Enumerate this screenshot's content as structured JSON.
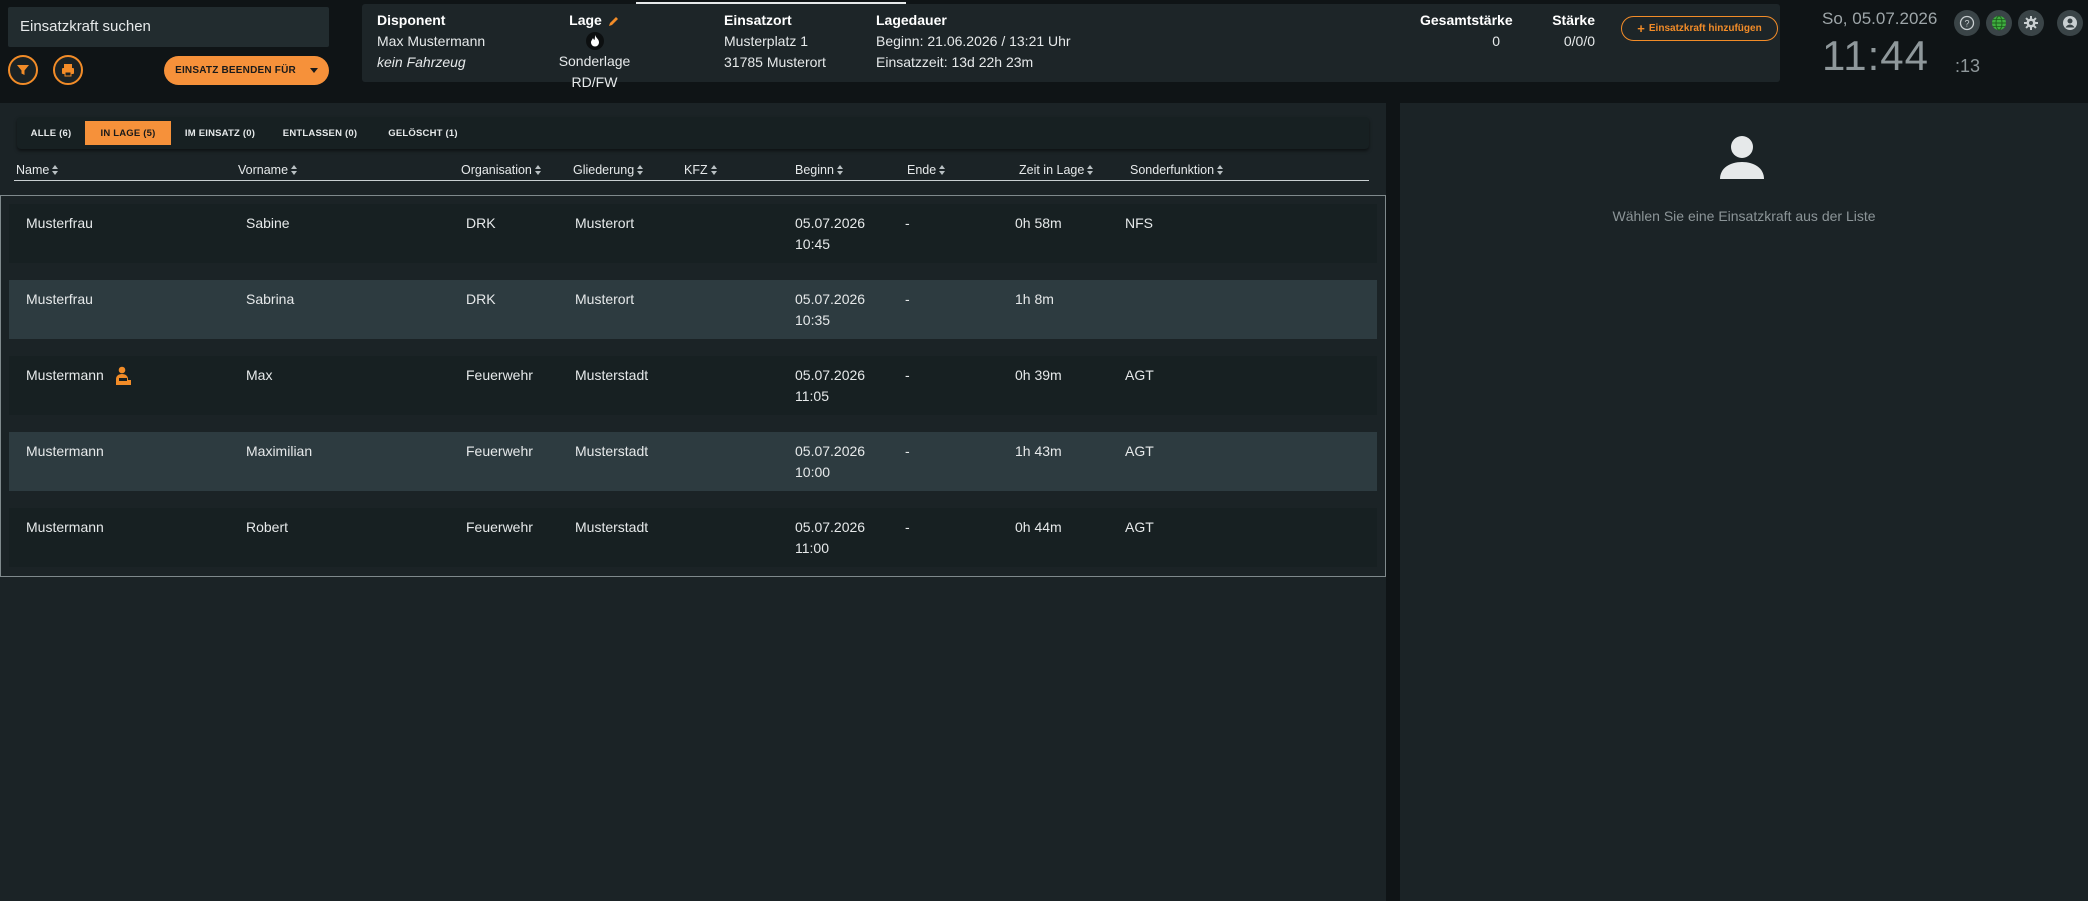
{
  "search": {
    "label": "Einsatzkraft suchen"
  },
  "toolbar": {
    "end_label": "EINSATZ BEENDEN FÜR"
  },
  "info": {
    "disponent_header": "Disponent",
    "disponent_name": "Max Mustermann",
    "disponent_vehicle": "kein Fahrzeug",
    "lage_header": "Lage",
    "lage_value": "Sonderlage RD/FW",
    "einsatzort_header": "Einsatzort",
    "einsatzort_street": "Musterplatz 1",
    "einsatzort_city": "31785 Musterort",
    "lagedauer_header": "Lagedauer",
    "lagedauer_begin": "Beginn: 21.06.2026 / 13:21 Uhr",
    "lagedauer_time": "Einsatzzeit: 13d 22h 23m",
    "gesamt_header": "Gesamtstärke",
    "gesamt_value": "0",
    "staerke_header": "Stärke",
    "staerke_value": "0/0/0",
    "add_label": "Einsatzkraft hinzufügen"
  },
  "clock": {
    "date": "So, 05.07.2026",
    "time": "11:44",
    "seconds": ":13"
  },
  "tabs": [
    {
      "label": "ALLE (6)",
      "active": false
    },
    {
      "label": "IN LAGE (5)",
      "active": true
    },
    {
      "label": "IM EINSATZ (0)",
      "active": false
    },
    {
      "label": "ENTLASSEN (0)",
      "active": false
    },
    {
      "label": "GELÖSCHT (1)",
      "active": false
    }
  ],
  "columns": [
    "Name",
    "Vorname",
    "Organisation",
    "Gliederung",
    "KFZ",
    "Beginn",
    "Ende",
    "Zeit in Lage",
    "Sonderfunktion"
  ],
  "rows": [
    {
      "name": "Musterfrau",
      "vorname": "Sabine",
      "org": "DRK",
      "gliederung": "Musterort",
      "kfz": "",
      "beginn_date": "05.07.2026",
      "beginn_time": "10:45",
      "ende": "-",
      "zeit": "0h 58m",
      "sonderfunktion": "NFS",
      "leader_icon": false
    },
    {
      "name": "Musterfrau",
      "vorname": "Sabrina",
      "org": "DRK",
      "gliederung": "Musterort",
      "kfz": "",
      "beginn_date": "05.07.2026",
      "beginn_time": "10:35",
      "ende": "-",
      "zeit": "1h 8m",
      "sonderfunktion": "",
      "leader_icon": false
    },
    {
      "name": "Mustermann",
      "vorname": "Max",
      "org": "Feuerwehr",
      "gliederung": "Musterstadt",
      "kfz": "",
      "beginn_date": "05.07.2026",
      "beginn_time": "11:05",
      "ende": "-",
      "zeit": "0h 39m",
      "sonderfunktion": "AGT",
      "leader_icon": true
    },
    {
      "name": "Mustermann",
      "vorname": "Maximilian",
      "org": "Feuerwehr",
      "gliederung": "Musterstadt",
      "kfz": "",
      "beginn_date": "05.07.2026",
      "beginn_time": "10:00",
      "ende": "-",
      "zeit": "1h 43m",
      "sonderfunktion": "AGT",
      "leader_icon": false
    },
    {
      "name": "Mustermann",
      "vorname": "Robert",
      "org": "Feuerwehr",
      "gliederung": "Musterstadt",
      "kfz": "",
      "beginn_date": "05.07.2026",
      "beginn_time": "11:00",
      "ende": "-",
      "zeit": "0h 44m",
      "sonderfunktion": "AGT",
      "leader_icon": false
    }
  ],
  "detail": {
    "hint": "Wählen Sie eine Einsatzkraft aus der Liste"
  },
  "colors": {
    "accent": "#f6913a",
    "panel": "#1b2326",
    "row_alt": "#2d3b40"
  }
}
